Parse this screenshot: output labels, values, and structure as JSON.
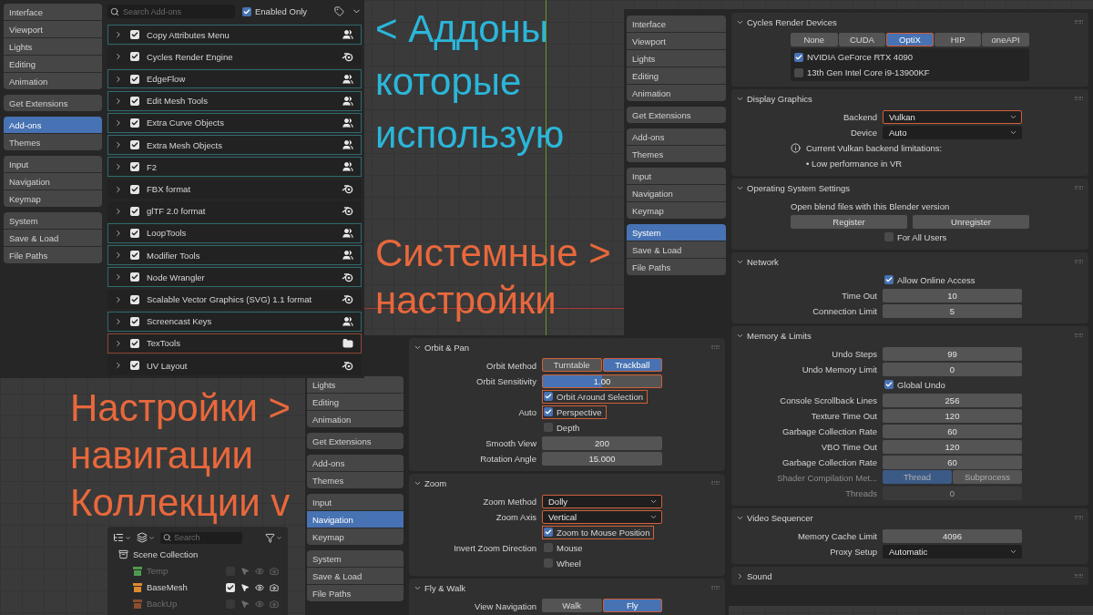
{
  "addons_window": {
    "sidebar": [
      [
        {
          "label": "Interface",
          "selected": false
        },
        {
          "label": "Viewport",
          "selected": false
        },
        {
          "label": "Lights",
          "selected": false
        },
        {
          "label": "Editing",
          "selected": false
        },
        {
          "label": "Animation",
          "selected": false
        }
      ],
      [
        {
          "label": "Get Extensions",
          "selected": false
        }
      ],
      [
        {
          "label": "Add-ons",
          "selected": true
        },
        {
          "label": "Themes",
          "selected": false
        }
      ],
      [
        {
          "label": "Input",
          "selected": false
        },
        {
          "label": "Navigation",
          "selected": false
        },
        {
          "label": "Keymap",
          "selected": false
        }
      ],
      [
        {
          "label": "System",
          "selected": false
        },
        {
          "label": "Save & Load",
          "selected": false
        },
        {
          "label": "File Paths",
          "selected": false
        }
      ]
    ],
    "search": {
      "placeholder": "Search Add-ons"
    },
    "enabled_only": {
      "label": "Enabled Only",
      "checked": true
    },
    "addons": [
      {
        "name": "Copy Attributes Menu",
        "enabled": true,
        "kind": "community",
        "color": "#2f6a6e"
      },
      {
        "name": "Cycles Render Engine",
        "enabled": true,
        "kind": "core"
      },
      {
        "name": "EdgeFlow",
        "enabled": true,
        "kind": "community",
        "color": "#2f6a6e"
      },
      {
        "name": "Edit Mesh Tools",
        "enabled": true,
        "kind": "community",
        "color": "#2f6a6e"
      },
      {
        "name": "Extra Curve Objects",
        "enabled": true,
        "kind": "community",
        "color": "#2f6a6e"
      },
      {
        "name": "Extra Mesh Objects",
        "enabled": true,
        "kind": "community",
        "color": "#2f6a6e"
      },
      {
        "name": "F2",
        "enabled": true,
        "kind": "community",
        "color": "#2f6a6e"
      },
      {
        "name": "FBX format",
        "enabled": true,
        "kind": "core"
      },
      {
        "name": "glTF 2.0 format",
        "enabled": true,
        "kind": "core"
      },
      {
        "name": "LoopTools",
        "enabled": true,
        "kind": "community",
        "color": "#2f6a6e"
      },
      {
        "name": "Modifier Tools",
        "enabled": true,
        "kind": "community",
        "color": "#2f6a6e"
      },
      {
        "name": "Node Wrangler",
        "enabled": true,
        "kind": "core",
        "color": "#2f6a6e"
      },
      {
        "name": "Scalable Vector Graphics (SVG) 1.1 format",
        "enabled": true,
        "kind": "core"
      },
      {
        "name": "Screencast Keys",
        "enabled": true,
        "kind": "community",
        "color": "#2f6a6e"
      },
      {
        "name": "TexTools",
        "enabled": true,
        "kind": "local",
        "color": "#8a4a30"
      },
      {
        "name": "UV Layout",
        "enabled": true,
        "kind": "core"
      }
    ]
  },
  "annotations": [
    {
      "lines": [
        "< Аддоны",
        "которые",
        "использую"
      ],
      "color": "#2bb6d9"
    },
    {
      "lines": [
        "Системные >",
        "настройки"
      ],
      "color": "#e8683c"
    },
    {
      "lines": [
        "Настройки >",
        "навигации",
        "Коллекции v"
      ],
      "color": "#e8683c"
    }
  ],
  "navigation_window": {
    "sidebar": [
      [
        {
          "label": "Lights",
          "selected": false
        },
        {
          "label": "Editing",
          "selected": false
        },
        {
          "label": "Animation",
          "selected": false
        }
      ],
      [
        {
          "label": "Get Extensions",
          "selected": false
        }
      ],
      [
        {
          "label": "Add-ons",
          "selected": false
        },
        {
          "label": "Themes",
          "selected": false
        }
      ],
      [
        {
          "label": "Input",
          "selected": false
        },
        {
          "label": "Navigation",
          "selected": true
        },
        {
          "label": "Keymap",
          "selected": false
        }
      ],
      [
        {
          "label": "System",
          "selected": false
        },
        {
          "label": "Save & Load",
          "selected": false
        },
        {
          "label": "File Paths",
          "selected": false
        }
      ]
    ],
    "sections": [
      {
        "title": "Orbit & Pan",
        "expanded": true,
        "rows": [
          {
            "kind": "toggle",
            "label": "Orbit Method",
            "disabled": false,
            "options": [
              {
                "label": "Turntable",
                "selected": false,
                "highlighted": true
              },
              {
                "label": "Trackball",
                "selected": true,
                "highlighted": true
              }
            ]
          },
          {
            "kind": "slider",
            "label": "Orbit Sensitivity",
            "value": "1.00",
            "level": 0.5,
            "highlighted": true
          },
          {
            "kind": "checkbox",
            "text": "Orbit Around Selection",
            "checked": true,
            "highlighted": true
          },
          {
            "kind": "checkbox",
            "label": "Auto",
            "text": "Perspective",
            "checked": true,
            "highlighted": true
          },
          {
            "kind": "checkbox",
            "text": "Depth",
            "checked": false,
            "highlighted": false
          },
          {
            "kind": "number",
            "label": "Smooth View",
            "value": "200",
            "disabled": false
          },
          {
            "kind": "number",
            "label": "Rotation Angle",
            "value": "15.000",
            "disabled": false
          }
        ]
      },
      {
        "title": "Zoom",
        "expanded": true,
        "rows": [
          {
            "kind": "dropdown",
            "label": "Zoom Method",
            "value": "Dolly",
            "highlighted": true
          },
          {
            "kind": "dropdown",
            "label": "Zoom Axis",
            "value": "Vertical",
            "highlighted": true
          },
          {
            "kind": "checkbox",
            "text": "Zoom to Mouse Position",
            "checked": true,
            "highlighted": true
          },
          {
            "kind": "checkbox",
            "label": "Invert Zoom Direction",
            "text": "Mouse",
            "checked": false,
            "highlighted": false
          },
          {
            "kind": "checkbox",
            "text": "Wheel",
            "checked": false,
            "highlighted": false
          }
        ]
      },
      {
        "title": "Fly & Walk",
        "expanded": true,
        "rows": [
          {
            "kind": "toggle",
            "label": "View Navigation",
            "disabled": false,
            "options": [
              {
                "label": "Walk",
                "selected": false,
                "highlighted": false
              },
              {
                "label": "Fly",
                "selected": true,
                "highlighted": true
              }
            ]
          }
        ]
      }
    ]
  },
  "system_window": {
    "sidebar": [
      [
        {
          "label": "Interface",
          "selected": false
        },
        {
          "label": "Viewport",
          "selected": false
        },
        {
          "label": "Lights",
          "selected": false
        },
        {
          "label": "Editing",
          "selected": false
        },
        {
          "label": "Animation",
          "selected": false
        }
      ],
      [
        {
          "label": "Get Extensions",
          "selected": false
        }
      ],
      [
        {
          "label": "Add-ons",
          "selected": false
        },
        {
          "label": "Themes",
          "selected": false
        }
      ],
      [
        {
          "label": "Input",
          "selected": false
        },
        {
          "label": "Navigation",
          "selected": false
        },
        {
          "label": "Keymap",
          "selected": false
        }
      ],
      [
        {
          "label": "System",
          "selected": true
        },
        {
          "label": "Save & Load",
          "selected": false
        },
        {
          "label": "File Paths",
          "selected": false
        }
      ]
    ],
    "sections": [
      {
        "title": "Cycles Render Devices",
        "expanded": true,
        "rows": [
          {
            "kind": "toggle",
            "disabled": false,
            "options": [
              {
                "label": "None",
                "selected": false,
                "highlighted": false
              },
              {
                "label": "CUDA",
                "selected": false,
                "highlighted": false
              },
              {
                "label": "OptiX",
                "selected": true,
                "highlighted": true
              },
              {
                "label": "HIP",
                "selected": false,
                "highlighted": false
              },
              {
                "label": "oneAPI",
                "selected": false,
                "highlighted": false
              }
            ]
          },
          {
            "kind": "devices",
            "items": [
              {
                "name": "NVIDIA GeForce RTX 4090",
                "checked": true
              },
              {
                "name": "13th Gen Intel Core i9-13900KF",
                "checked": false
              }
            ]
          }
        ]
      },
      {
        "title": "Display Graphics",
        "expanded": true,
        "rows": [
          {
            "kind": "dropdown",
            "label": "Backend",
            "value": "Vulkan",
            "highlighted": true
          },
          {
            "kind": "dropdown",
            "label": "Device",
            "value": "Auto",
            "highlighted": false
          },
          {
            "kind": "info",
            "text": "Current Vulkan backend limitations:"
          },
          {
            "kind": "bullet",
            "text": "• Low performance in VR"
          }
        ]
      },
      {
        "title": "Operating System Settings",
        "expanded": true,
        "rows": [
          {
            "kind": "note",
            "text": "Open blend files with this Blender version"
          },
          {
            "kind": "buttons",
            "buttons": [
              "Register",
              "Unregister"
            ]
          },
          {
            "kind": "checkbox",
            "text": "For All Users",
            "checked": false,
            "highlighted": false
          }
        ]
      },
      {
        "title": "Network",
        "expanded": true,
        "rows": [
          {
            "kind": "checkbox",
            "text": "Allow Online Access",
            "checked": true,
            "highlighted": false
          },
          {
            "kind": "number",
            "label": "Time Out",
            "value": "10",
            "disabled": false
          },
          {
            "kind": "number",
            "label": "Connection Limit",
            "value": "5",
            "disabled": false
          }
        ]
      },
      {
        "title": "Memory & Limits",
        "expanded": true,
        "rows": [
          {
            "kind": "number",
            "label": "Undo Steps",
            "value": "99",
            "disabled": false
          },
          {
            "kind": "number",
            "label": "Undo Memory Limit",
            "value": "0",
            "disabled": false
          },
          {
            "kind": "checkbox",
            "text": "Global Undo",
            "checked": true,
            "highlighted": false
          },
          {
            "kind": "number",
            "label": "Console Scrollback Lines",
            "value": "256",
            "disabled": false
          },
          {
            "kind": "number",
            "label": "Texture Time Out",
            "value": "120",
            "disabled": false
          },
          {
            "kind": "number",
            "label": "Garbage Collection Rate",
            "value": "60",
            "disabled": false
          },
          {
            "kind": "number",
            "label": "VBO Time Out",
            "value": "120",
            "disabled": false
          },
          {
            "kind": "number",
            "label": "Garbage Collection Rate",
            "value": "60",
            "disabled": false
          },
          {
            "kind": "toggle",
            "label": "Shader Compilation Met...",
            "disabled": true,
            "options": [
              {
                "label": "Thread",
                "selected": true,
                "highlighted": false
              },
              {
                "label": "Subprocess",
                "selected": false,
                "highlighted": false
              }
            ]
          },
          {
            "kind": "number",
            "label": "Threads",
            "value": "0",
            "disabled": true
          }
        ]
      },
      {
        "title": "Video Sequencer",
        "expanded": true,
        "rows": [
          {
            "kind": "number",
            "label": "Memory Cache Limit",
            "value": "4096",
            "disabled": false
          },
          {
            "kind": "dropdown",
            "label": "Proxy Setup",
            "value": "Automatic",
            "highlighted": false
          }
        ]
      },
      {
        "title": "Sound",
        "expanded": false
      }
    ]
  },
  "outliner": {
    "search": {
      "placeholder": "Search"
    },
    "root": {
      "name": "Scene Collection",
      "children": [
        {
          "name": "Temp",
          "color": "#4f9a4f",
          "checked": false
        },
        {
          "name": "BaseMesh",
          "color": "#e08a2e",
          "checked": true
        },
        {
          "name": "BackUp",
          "color": "#8a4e2e",
          "checked": false
        }
      ]
    }
  }
}
